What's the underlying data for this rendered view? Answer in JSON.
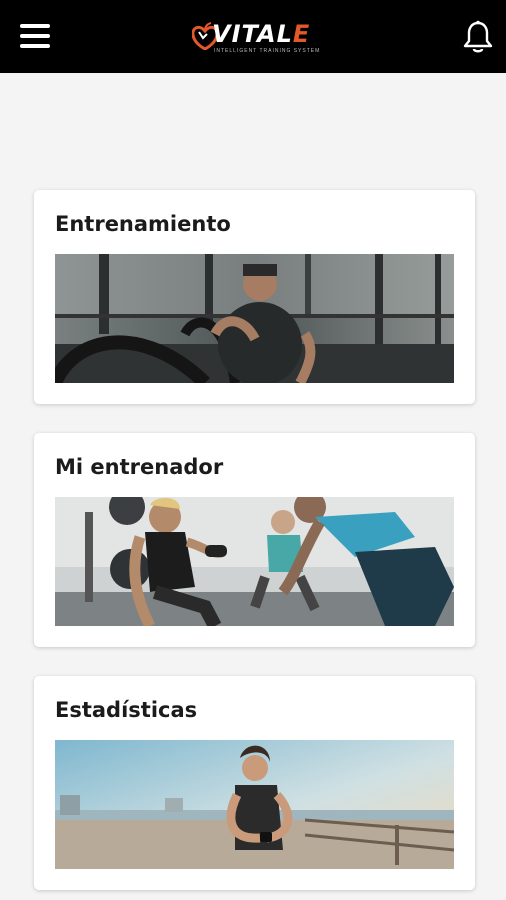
{
  "header": {
    "logo_text_left": "VITAL",
    "logo_text_right": "E",
    "logo_tagline": "INTELLIGENT TRAINING SYSTEM",
    "icons": [
      "menu-icon",
      "notification-bell-icon"
    ],
    "accent_color": "#e4592a"
  },
  "cards": [
    {
      "title": "Entrenamiento",
      "image": "battle-ropes-training-photo"
    },
    {
      "title": "Mi entrenador",
      "image": "group-dumbbell-training-photo"
    },
    {
      "title": "Estadísticas",
      "image": "runner-checking-smartwatch-photo"
    }
  ]
}
